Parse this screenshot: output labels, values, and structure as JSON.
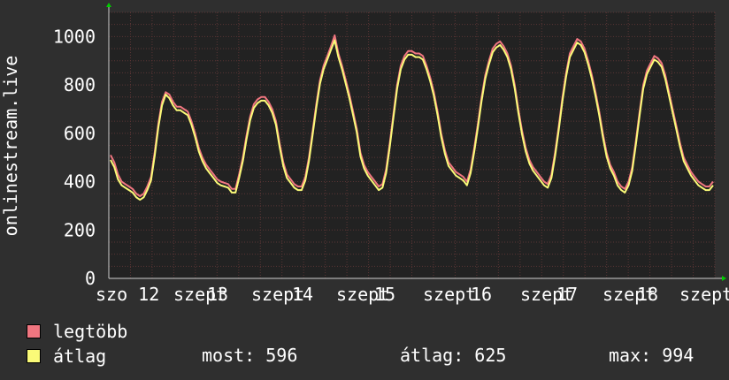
{
  "colors": {
    "background": "#2f2f2f",
    "plot_background": "#222222",
    "grid": "#5a3535",
    "axis": "#cccccc",
    "max_series": "#f07680",
    "avg_series": "#fafa78"
  },
  "chart_data": {
    "type": "line",
    "ylabel": "onlinestream.live",
    "ylim": [
      0,
      1100
    ],
    "yticks": [
      0,
      200,
      400,
      600,
      800,
      1000
    ],
    "grid": true,
    "xtick_labels": [
      "szo 12",
      "szept",
      "13",
      "szept",
      "14",
      "szept",
      "15",
      "szept",
      "16",
      "szept",
      "17",
      "szept",
      "18",
      "szept"
    ],
    "series": [
      {
        "name": "legtöbb",
        "color": "#f07680",
        "values": [
          510,
          480,
          430,
          400,
          390,
          380,
          370,
          350,
          340,
          350,
          380,
          420,
          520,
          640,
          730,
          770,
          760,
          730,
          710,
          710,
          700,
          690,
          650,
          600,
          540,
          500,
          470,
          450,
          430,
          410,
          400,
          395,
          390,
          370,
          370,
          430,
          500,
          590,
          670,
          720,
          740,
          750,
          750,
          730,
          700,
          650,
          560,
          480,
          430,
          410,
          390,
          380,
          380,
          420,
          500,
          610,
          720,
          820,
          880,
          920,
          960,
          1005,
          930,
          880,
          820,
          760,
          690,
          620,
          520,
          470,
          440,
          420,
          400,
          380,
          390,
          450,
          560,
          680,
          800,
          880,
          920,
          940,
          940,
          930,
          930,
          920,
          880,
          830,
          770,
          690,
          600,
          530,
          480,
          460,
          440,
          430,
          420,
          400,
          450,
          540,
          640,
          750,
          840,
          900,
          950,
          970,
          980,
          960,
          930,
          880,
          800,
          700,
          610,
          540,
          490,
          460,
          440,
          420,
          400,
          390,
          430,
          520,
          630,
          750,
          850,
          930,
          960,
          990,
          980,
          950,
          900,
          840,
          770,
          690,
          600,
          520,
          470,
          440,
          400,
          380,
          370,
          400,
          460,
          570,
          690,
          800,
          860,
          890,
          920,
          910,
          890,
          840,
          770,
          700,
          630,
          560,
          500,
          470,
          440,
          420,
          400,
          390,
          380,
          380,
          400
        ]
      },
      {
        "name": "átlag",
        "color": "#fafa78",
        "values": [
          490,
          460,
          410,
          385,
          375,
          365,
          355,
          335,
          325,
          335,
          365,
          405,
          505,
          625,
          715,
          760,
          745,
          715,
          695,
          695,
          685,
          675,
          635,
          585,
          525,
          485,
          455,
          435,
          415,
          395,
          385,
          380,
          375,
          355,
          355,
          415,
          485,
          575,
          655,
          705,
          725,
          735,
          735,
          715,
          685,
          635,
          545,
          465,
          415,
          395,
          375,
          365,
          365,
          405,
          485,
          595,
          705,
          805,
          865,
          905,
          945,
          985,
          915,
          865,
          805,
          745,
          675,
          605,
          505,
          455,
          425,
          405,
          385,
          365,
          375,
          435,
          545,
          665,
          785,
          865,
          905,
          925,
          925,
          915,
          915,
          905,
          865,
          815,
          755,
          675,
          585,
          515,
          465,
          445,
          425,
          415,
          405,
          385,
          435,
          525,
          625,
          735,
          825,
          885,
          935,
          955,
          965,
          945,
          915,
          865,
          785,
          685,
          595,
          525,
          475,
          445,
          425,
          405,
          385,
          375,
          415,
          505,
          615,
          735,
          835,
          915,
          945,
          975,
          965,
          935,
          885,
          825,
          755,
          675,
          585,
          505,
          455,
          425,
          385,
          365,
          355,
          385,
          445,
          555,
          675,
          785,
          845,
          875,
          905,
          895,
          875,
          825,
          755,
          685,
          615,
          545,
          485,
          455,
          425,
          405,
          385,
          375,
          365,
          365,
          385
        ]
      }
    ]
  },
  "legend": {
    "max_label": "legtöbb",
    "avg_label": "átlag"
  },
  "stats": {
    "now_label": "most:",
    "now_value": "596",
    "avg_label": "átlag:",
    "avg_value": "625",
    "max_label": "max:",
    "max_value": "994"
  }
}
